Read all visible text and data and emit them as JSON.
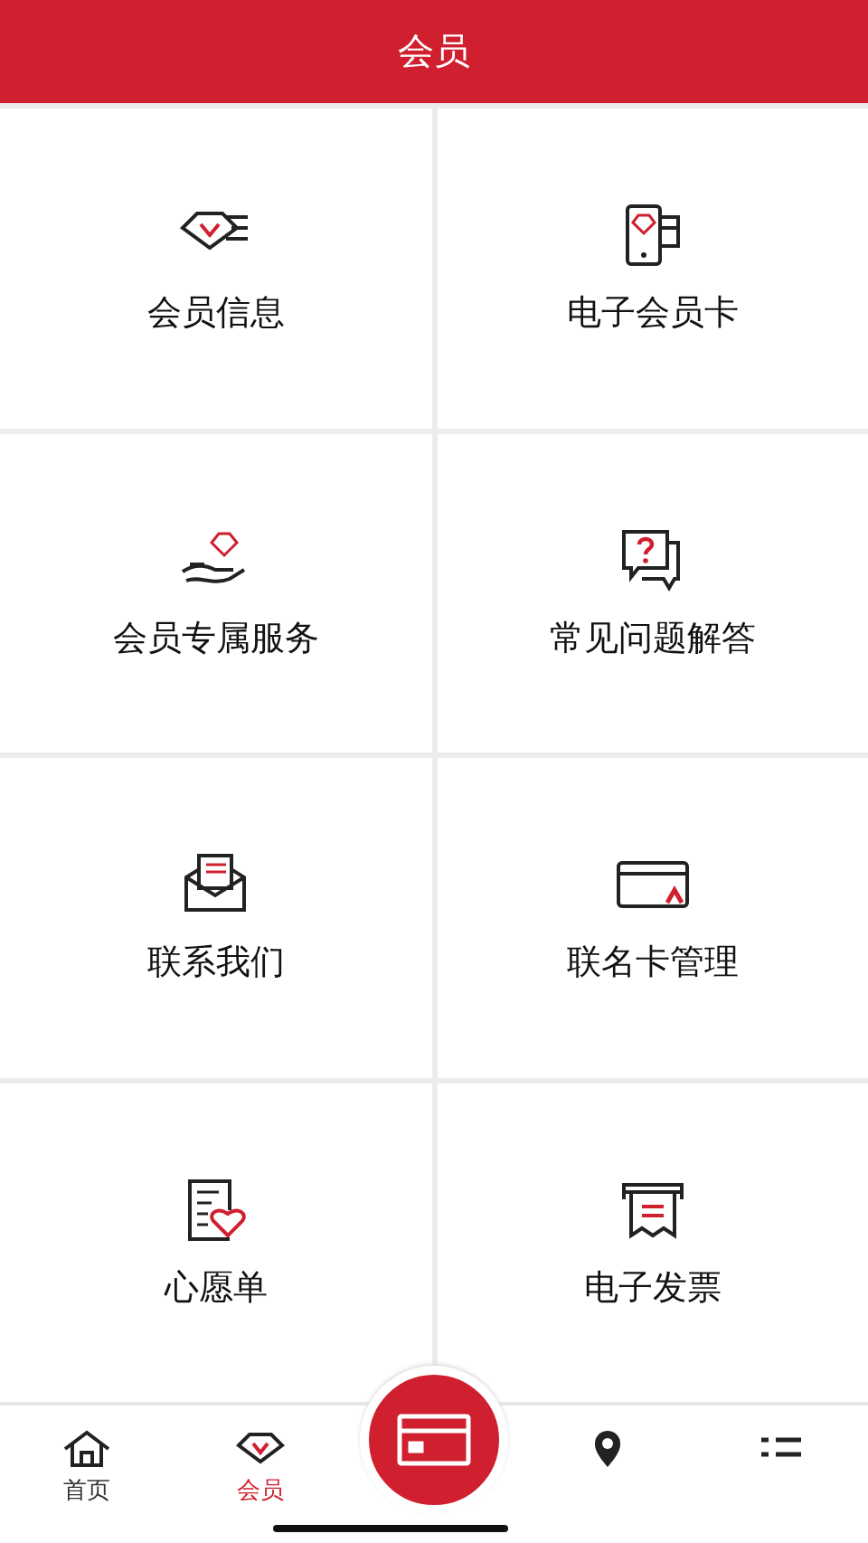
{
  "header": {
    "title": "会员"
  },
  "menu": [
    {
      "label": "会员信息"
    },
    {
      "label": "电子会员卡"
    },
    {
      "label": "会员专属服务"
    },
    {
      "label": "常见问题解答"
    },
    {
      "label": "联系我们"
    },
    {
      "label": "联名卡管理"
    },
    {
      "label": "心愿单"
    },
    {
      "label": "电子发票"
    }
  ],
  "tab_bar": [
    {
      "kind": "tab",
      "label": "首页",
      "selected": false
    },
    {
      "kind": "tab",
      "label": "会员",
      "selected": true
    },
    {
      "kind": "center",
      "selected": false
    },
    {
      "kind": "tab",
      "selected": false
    },
    {
      "kind": "tab",
      "selected": false
    }
  ]
}
